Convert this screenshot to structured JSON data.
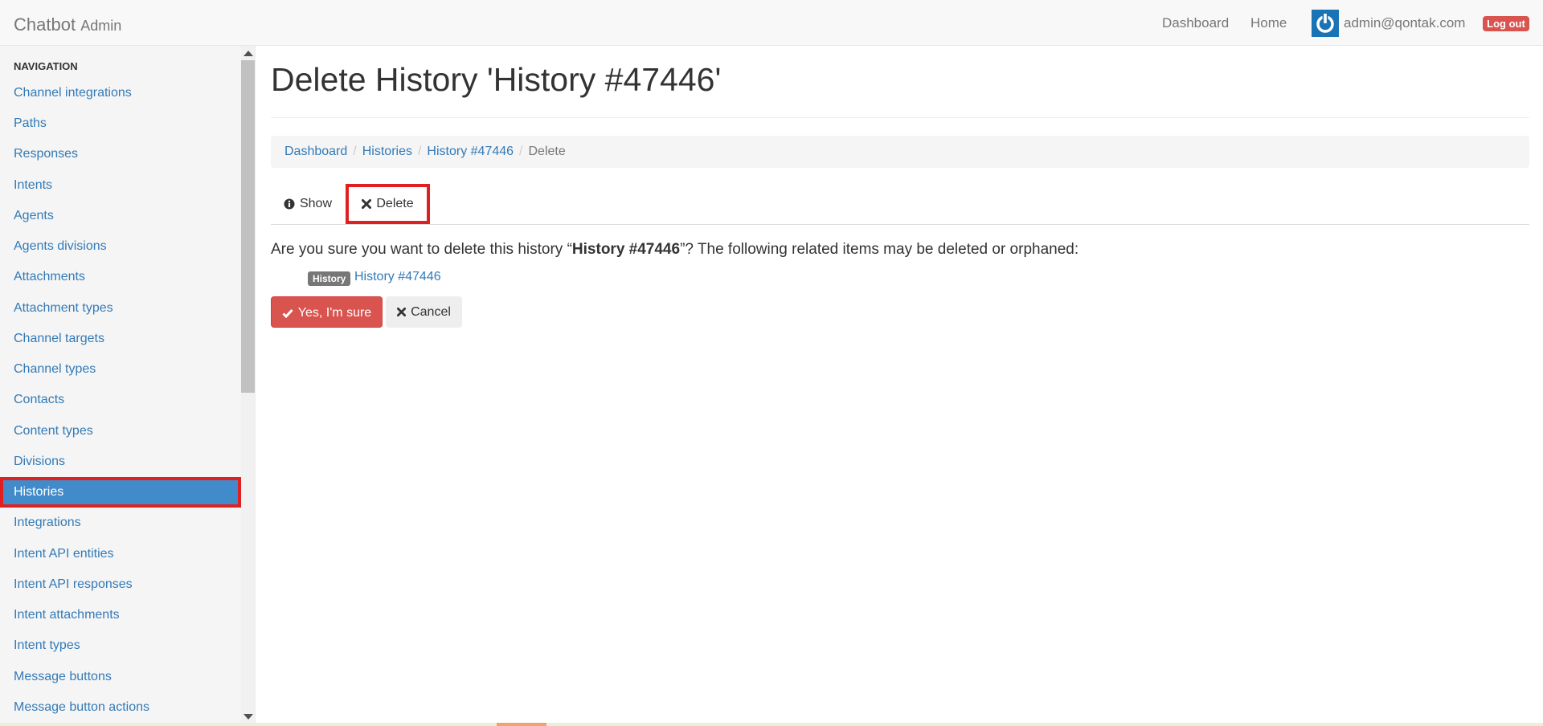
{
  "navbar": {
    "brand": "Chatbot",
    "brand_sub": "Admin",
    "links": [
      "Dashboard",
      "Home"
    ],
    "user_email": "admin@qontak.com",
    "logout_label": "Log out"
  },
  "sidebar": {
    "header": "NAVIGATION",
    "items": [
      {
        "label": "Channel integrations"
      },
      {
        "label": "Paths"
      },
      {
        "label": "Responses"
      },
      {
        "label": "Intents"
      },
      {
        "label": "Agents"
      },
      {
        "label": "Agents divisions"
      },
      {
        "label": "Attachments"
      },
      {
        "label": "Attachment types"
      },
      {
        "label": "Channel targets"
      },
      {
        "label": "Channel types"
      },
      {
        "label": "Contacts"
      },
      {
        "label": "Content types"
      },
      {
        "label": "Divisions"
      },
      {
        "label": "Histories",
        "active": true
      },
      {
        "label": "Integrations"
      },
      {
        "label": "Intent API entities"
      },
      {
        "label": "Intent API responses"
      },
      {
        "label": "Intent attachments"
      },
      {
        "label": "Intent types"
      },
      {
        "label": "Message buttons"
      },
      {
        "label": "Message button actions"
      }
    ]
  },
  "main": {
    "title": "Delete History 'History #47446'",
    "breadcrumb": [
      "Dashboard",
      "Histories",
      "History #47446",
      "Delete"
    ],
    "tabs": [
      {
        "label": "Show",
        "icon": "info-circle-icon"
      },
      {
        "label": "Delete",
        "icon": "times-icon",
        "active": true
      }
    ],
    "confirm": {
      "prefix": "Are you sure you want to delete this history “",
      "name": "History #47446",
      "suffix": "”? The following related items may be deleted or orphaned:"
    },
    "related": {
      "badge": "History",
      "link": "History #47446"
    },
    "buttons": {
      "confirm": "Yes, I'm sure",
      "cancel": "Cancel"
    }
  },
  "colors": {
    "link": "#337ab7",
    "danger": "#d9534f",
    "active_nav": "#428bca",
    "highlight": "#e02020"
  }
}
